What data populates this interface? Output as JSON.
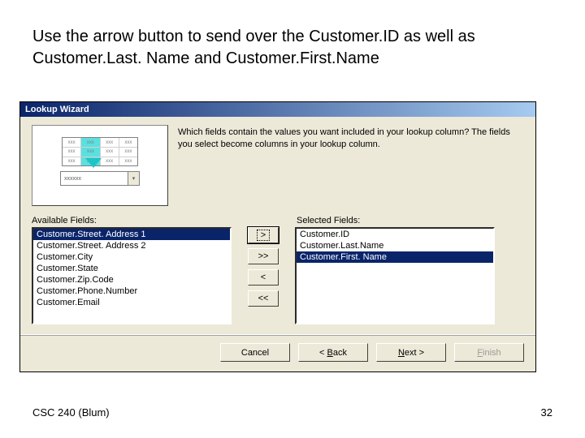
{
  "slide": {
    "instruction": "Use the arrow button to send over the Customer.ID as well as Customer.Last. Name and Customer.First.Name",
    "footer_left": "CSC 240 (Blum)",
    "page_number": "32"
  },
  "wizard": {
    "title": "Lookup Wizard",
    "prompt": "Which fields contain the values you want included in your lookup column? The fields you select become columns in your lookup column.",
    "available_label": "Available Fields:",
    "selected_label": "Selected Fields:",
    "available": [
      "Customer.Street. Address 1",
      "Customer.Street. Address 2",
      "Customer.City",
      "Customer.State",
      "Customer.Zip.Code",
      "Customer.Phone.Number",
      "Customer.Email"
    ],
    "available_selected_index": 0,
    "selected": [
      "Customer.ID",
      "Customer.Last.Name",
      "Customer.First. Name"
    ],
    "selected_selected_index": 2,
    "arrows": {
      "add": ">",
      "add_all": ">>",
      "remove": "<",
      "remove_all": "<<"
    },
    "buttons": {
      "cancel": "Cancel",
      "back": "< Back",
      "next": "Next >",
      "finish": "Finish"
    },
    "preview": {
      "cell": "xxx",
      "combo_text": "xxxxxx",
      "dropdown_glyph": "▾"
    }
  }
}
